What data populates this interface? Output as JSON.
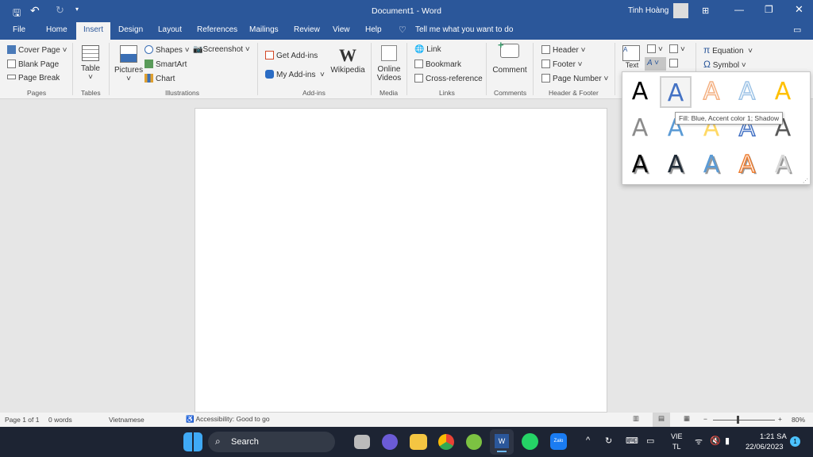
{
  "title_bar": {
    "document_title": "Document1  -  Word",
    "user_name": "Tinh Hoàng"
  },
  "tabs": [
    {
      "label": "File"
    },
    {
      "label": "Home"
    },
    {
      "label": "Insert",
      "active": true
    },
    {
      "label": "Design"
    },
    {
      "label": "Layout"
    },
    {
      "label": "References"
    },
    {
      "label": "Mailings"
    },
    {
      "label": "Review"
    },
    {
      "label": "View"
    },
    {
      "label": "Help"
    }
  ],
  "tell_me": "Tell me what you want to do",
  "ribbon": {
    "pages": {
      "label": "Pages",
      "items": [
        "Cover Page",
        "Blank Page",
        "Page Break"
      ]
    },
    "tables": {
      "label": "Tables",
      "table": "Table"
    },
    "illustrations": {
      "label": "Illustrations",
      "pictures": "Pictures",
      "shapes": "Shapes",
      "smartart": "SmartArt",
      "chart": "Chart",
      "screenshot": "Screenshot"
    },
    "addins": {
      "label": "Add-ins",
      "get": "Get Add-ins",
      "my": "My Add-ins",
      "wikipedia": "Wikipedia"
    },
    "media": {
      "label": "Media",
      "online_videos": "Online Videos"
    },
    "links": {
      "label": "Links",
      "items": [
        "Link",
        "Bookmark",
        "Cross-reference"
      ]
    },
    "comments": {
      "label": "Comments",
      "comment": "Comment"
    },
    "header_footer": {
      "label": "Header & Footer",
      "items": [
        "Header",
        "Footer",
        "Page Number"
      ]
    },
    "text": {
      "label": "Text"
    },
    "symbols": {
      "equation": "Equation",
      "symbol": "Symbol"
    }
  },
  "wordart_gallery": {
    "glyph": "A",
    "tooltip": "Fill: Blue, Accent color 1; Shadow",
    "colors": [
      "#000000",
      "#4472c4",
      "#f4b183",
      "#9dc3e6",
      "#ffc000",
      "#8c8c8c",
      "#5b9bd5",
      "#ffd966",
      "#4472c4",
      "#595959",
      "#000000",
      "#1f2a36",
      "#5b9bd5",
      "#ed7d31",
      "#d9d9d9"
    ]
  },
  "status_bar": {
    "page": "Page 1 of 1",
    "words": "0 words",
    "language": "Vietnamese",
    "accessibility": "Accessibility: Good to go",
    "zoom": "80%",
    "zoom_fraction": 0.4
  },
  "taskbar": {
    "search": "Search",
    "lang_top": "VIE",
    "lang_bottom": "TL",
    "time": "1:21 SA",
    "date": "22/06/2023",
    "notifications": "1"
  },
  "colors": {
    "accent": "#2b579a"
  }
}
